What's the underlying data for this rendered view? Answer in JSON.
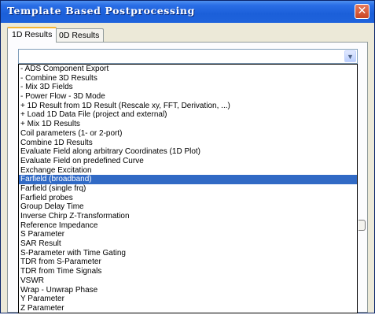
{
  "window": {
    "title": "Template Based Postprocessing",
    "close_label": "✕"
  },
  "tabs": [
    {
      "label": "1D Results",
      "active": true
    },
    {
      "label": "0D Results",
      "active": false
    }
  ],
  "combo": {
    "value": "",
    "dropdown_icon": "chevron-down-icon",
    "arrow_glyph": "▼"
  },
  "dropdown": {
    "items": [
      "- ADS Component Export",
      "- Combine 3D Results",
      "- Mix 3D Fields",
      "- Power Flow - 3D Mode",
      "+ 1D Result from 1D Result (Rescale xy, FFT, Derivation, ...)",
      "+ Load 1D Data File (project and external)",
      "+ Mix 1D Results",
      "Coil parameters (1- or 2-port)",
      "Combine 1D Results",
      "Evaluate Field along arbitrary Coordinates (1D Plot)",
      "Evaluate Field on predefined Curve",
      "Exchange Excitation",
      "Farfield (broadband)",
      "Farfield (single frq)",
      "Farfield probes",
      "Group Delay Time",
      "Inverse Chirp Z-Transformation",
      "Reference Impedance",
      "S Parameter",
      "SAR Result",
      "S-Parameter with Time Gating",
      "TDR from S-Parameter",
      "TDR from Time Signals",
      "VSWR",
      "Wrap - Unwrap Phase",
      "Y Parameter",
      "Z Parameter"
    ],
    "selected_index": 12
  },
  "colors": {
    "title_bar": "#1f63dc",
    "selection": "#316ac5",
    "close_button": "#c94522"
  }
}
